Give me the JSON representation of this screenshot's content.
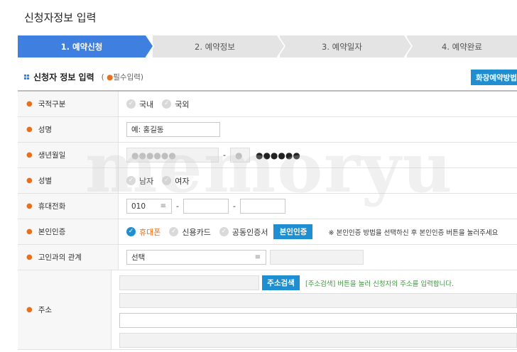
{
  "page": {
    "title": "신청자정보 입력"
  },
  "steps": [
    {
      "label": "1. 예약신청",
      "active": true
    },
    {
      "label": "2. 예약정보",
      "active": false
    },
    {
      "label": "3. 예약일자",
      "active": false
    },
    {
      "label": "4. 예약완료",
      "active": false
    }
  ],
  "section": {
    "title": "신청자 정보 입력",
    "required_open": "(",
    "required_dot": "●",
    "required_text": "필수입력)",
    "guide_button": "화장예약방법"
  },
  "form": {
    "bullet": "●",
    "nationality": {
      "label": "국적구분",
      "options": [
        "국내",
        "국외"
      ]
    },
    "name": {
      "label": "성명",
      "placeholder": "예: 홍길동"
    },
    "birth": {
      "label": "생년월일",
      "front_mask": "●●●●●●",
      "back_first_mask": "●",
      "back_rest_mask": "●●●●●●",
      "separator": "-"
    },
    "gender": {
      "label": "성별",
      "options": [
        "남자",
        "여자"
      ]
    },
    "mobile": {
      "label": "휴대전화",
      "prefix": "010",
      "separator": "-"
    },
    "verification": {
      "label": "본인인증",
      "options": [
        "휴대폰",
        "신용카드",
        "공동인증서"
      ],
      "selected": "휴대폰",
      "button": "본인인증",
      "note": "※ 본인인증 방법을 선택하신 후 본인인증 버튼을 눌러주세요"
    },
    "relation": {
      "label": "고인과의 관계",
      "select_value": "선택"
    },
    "address": {
      "label": "주소",
      "search_button": "주소검색",
      "note": "[주소검색] 버튼을 눌러 신청자의 주소를 입력합니다."
    }
  },
  "icons": {
    "check": "✓",
    "select_menu": "≡"
  },
  "watermark": "memoryu",
  "colors": {
    "primary": "#3f7fe0",
    "button": "#1f8fd1",
    "bullet": "#e8701a",
    "note_green": "#3c9b3c"
  }
}
